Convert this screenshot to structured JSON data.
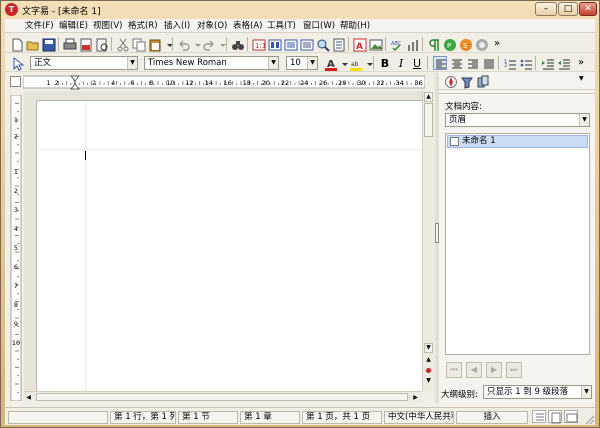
{
  "window": {
    "title": "文字易 - [未命名 1]",
    "app_icon_letter": "T"
  },
  "window_controls": {
    "minimize": "–",
    "maximize": "□",
    "close": "✕"
  },
  "menubar": [
    "文件(F)",
    "编辑(E)",
    "视图(V)",
    "格式(R)",
    "插入(I)",
    "对象(O)",
    "表格(A)",
    "工具(T)",
    "窗口(W)",
    "帮助(H)"
  ],
  "format_bar": {
    "style": "正文",
    "font": "Times New Roman",
    "size": "10",
    "font_color_letter": "A",
    "bold": "B",
    "italic": "I",
    "underline": "U"
  },
  "toolbar_overflow": "»",
  "side_panel": {
    "content_label": "文档内容:",
    "content_select": "页眉",
    "outline_item": "未命名 1",
    "outline_level_label": "大纲级别:",
    "outline_level_select": "只显示 1 到 9 级段落"
  },
  "statusbar": {
    "line_col": "第 1 行，第 1 列",
    "section": "第 1 节",
    "chapter": "第 1 章",
    "page": "第 1 页，共 1 页",
    "language": "中文(中华人民共和",
    "mode": "插入"
  },
  "colors": {
    "selection": "#c9dcf3",
    "font_color": "#d02020",
    "highlight": "#f4e000",
    "title_gradient": "#e5c48f"
  },
  "ruler_numbers": [
    "1",
    "2",
    "1",
    "2",
    "4",
    "6",
    "8",
    "10",
    "12",
    "14",
    "16",
    "18",
    "20",
    "22",
    "24",
    "26",
    "28",
    "30",
    "32",
    "34",
    "36"
  ],
  "vruler_numbers": [
    "1",
    "2",
    "1",
    "2",
    "3",
    "4",
    "5",
    "6",
    "7",
    "8",
    "9",
    "10"
  ]
}
